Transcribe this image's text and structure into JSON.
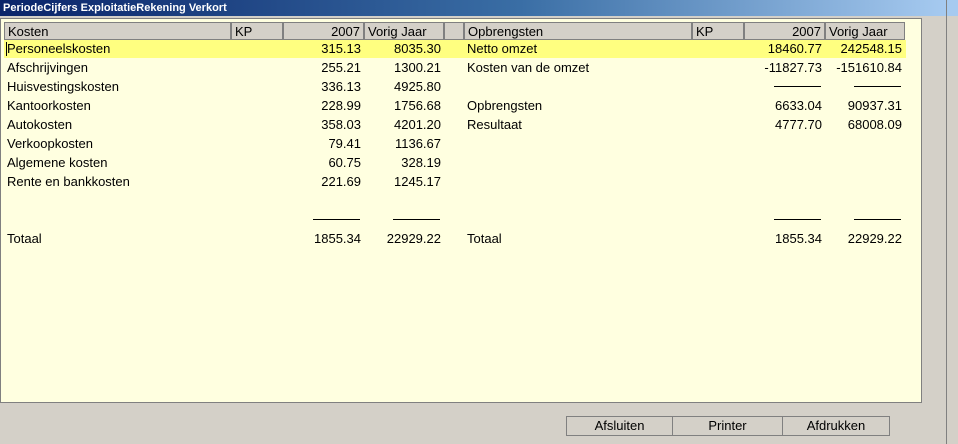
{
  "window": {
    "title": "PeriodeCijfers ExploitatieRekening Verkort"
  },
  "left": {
    "headers": {
      "kosten": "Kosten",
      "kp": "KP",
      "year": "2007",
      "prev": "Vorig Jaar"
    },
    "rows": [
      {
        "label": "Personeelskosten",
        "year": "315.13",
        "prev": "8035.30"
      },
      {
        "label": "Afschrijvingen",
        "year": "255.21",
        "prev": "1300.21"
      },
      {
        "label": "Huisvestingskosten",
        "year": "336.13",
        "prev": "4925.80"
      },
      {
        "label": "Kantoorkosten",
        "year": "228.99",
        "prev": "1756.68"
      },
      {
        "label": "Autokosten",
        "year": "358.03",
        "prev": "4201.20"
      },
      {
        "label": "Verkoopkosten",
        "year": "79.41",
        "prev": "1136.67"
      },
      {
        "label": "Algemene kosten",
        "year": "60.75",
        "prev": "328.19"
      },
      {
        "label": "Rente en bankkosten",
        "year": "221.69",
        "prev": "1245.17"
      }
    ],
    "total": {
      "label": "Totaal",
      "year": "1855.34",
      "prev": "22929.22"
    }
  },
  "right": {
    "headers": {
      "opbrengsten": "Opbrengsten",
      "kp": "KP",
      "year": "2007",
      "prev": "Vorig Jaar"
    },
    "rows": [
      {
        "label": "Netto omzet",
        "year": "18460.77",
        "prev": "242548.15"
      },
      {
        "label": "Kosten van de omzet",
        "year": "-11827.73",
        "prev": "-151610.84"
      },
      {
        "label": "Opbrengsten",
        "year": "6633.04",
        "prev": "90937.31"
      },
      {
        "label": "Resultaat",
        "year": "4777.70",
        "prev": "68008.09"
      }
    ],
    "total": {
      "label": "Totaal",
      "year": "1855.34",
      "prev": "22929.22"
    }
  },
  "buttons": {
    "close": "Afsluiten",
    "printer": "Printer",
    "print": "Afdrukken"
  }
}
